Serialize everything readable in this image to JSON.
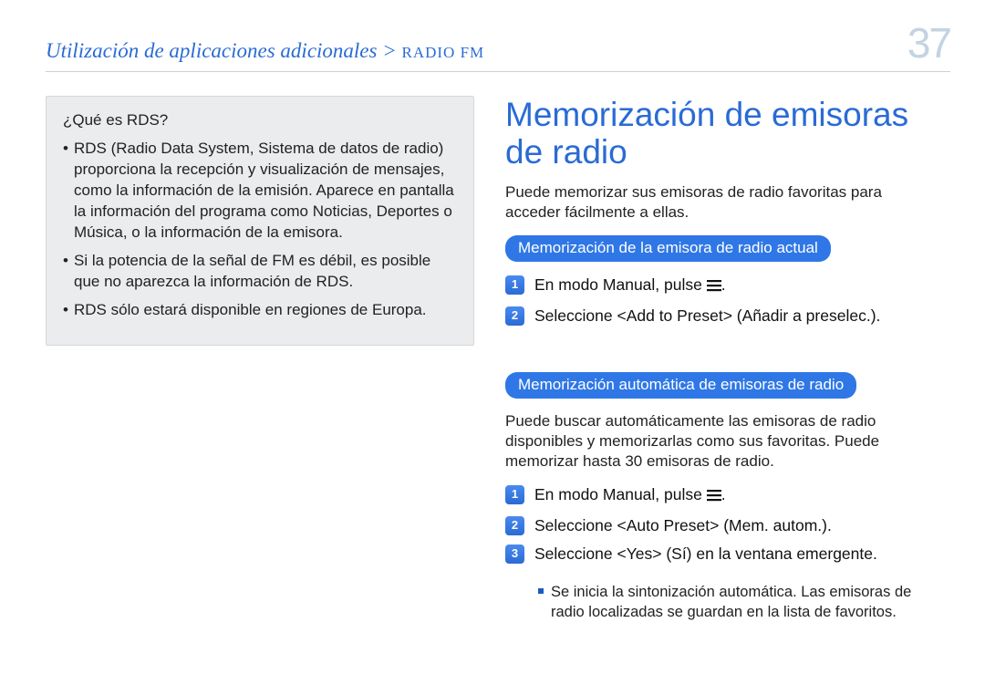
{
  "breadcrumb": {
    "main": "Utilización de aplicaciones adicionales",
    "sub": "RADIO FM"
  },
  "page_number": "37",
  "left": {
    "box_title": "¿Qué es RDS?",
    "items": [
      "RDS (Radio Data System, Sistema de datos de radio) proporciona la recepción y visualización de mensajes, como la información de la emisión. Aparece en pantalla la información del programa como Noticias, Deportes o Música, o la información de la emisora.",
      "Si la potencia de la señal de FM es débil, es posible que no aparezca la información de RDS.",
      "RDS sólo estará disponible en regiones de Europa."
    ]
  },
  "right": {
    "title": "Memorización de emisoras de radio",
    "intro": "Puede memorizar sus emisoras de radio favoritas para acceder fácilmente a ellas.",
    "section1": {
      "pill": "Memorización de la emisora de radio actual",
      "steps": [
        {
          "n": "1",
          "text_pre": "En modo Manual, pulse ",
          "icon": true,
          "text_post": "."
        },
        {
          "n": "2",
          "text_pre": "Seleccione <Add to Preset> (Añadir a preselec.).",
          "icon": false,
          "text_post": ""
        }
      ]
    },
    "section2": {
      "pill": "Memorización automática de emisoras de radio",
      "desc": "Puede buscar automáticamente las emisoras de radio disponibles y memorizarlas como sus favoritas. Puede memorizar hasta 30 emisoras de radio.",
      "steps": [
        {
          "n": "1",
          "text_pre": "En modo Manual, pulse ",
          "icon": true,
          "text_post": "."
        },
        {
          "n": "2",
          "text_pre": "Seleccione <Auto Preset> (Mem. autom.).",
          "icon": false,
          "text_post": ""
        },
        {
          "n": "3",
          "text_pre": "Seleccione <Yes> (Sí) en la ventana emergente.",
          "icon": false,
          "text_post": ""
        }
      ],
      "note": "Se inicia la sintonización automática. Las emisoras de radio localizadas se guardan en la lista de favoritos."
    }
  }
}
